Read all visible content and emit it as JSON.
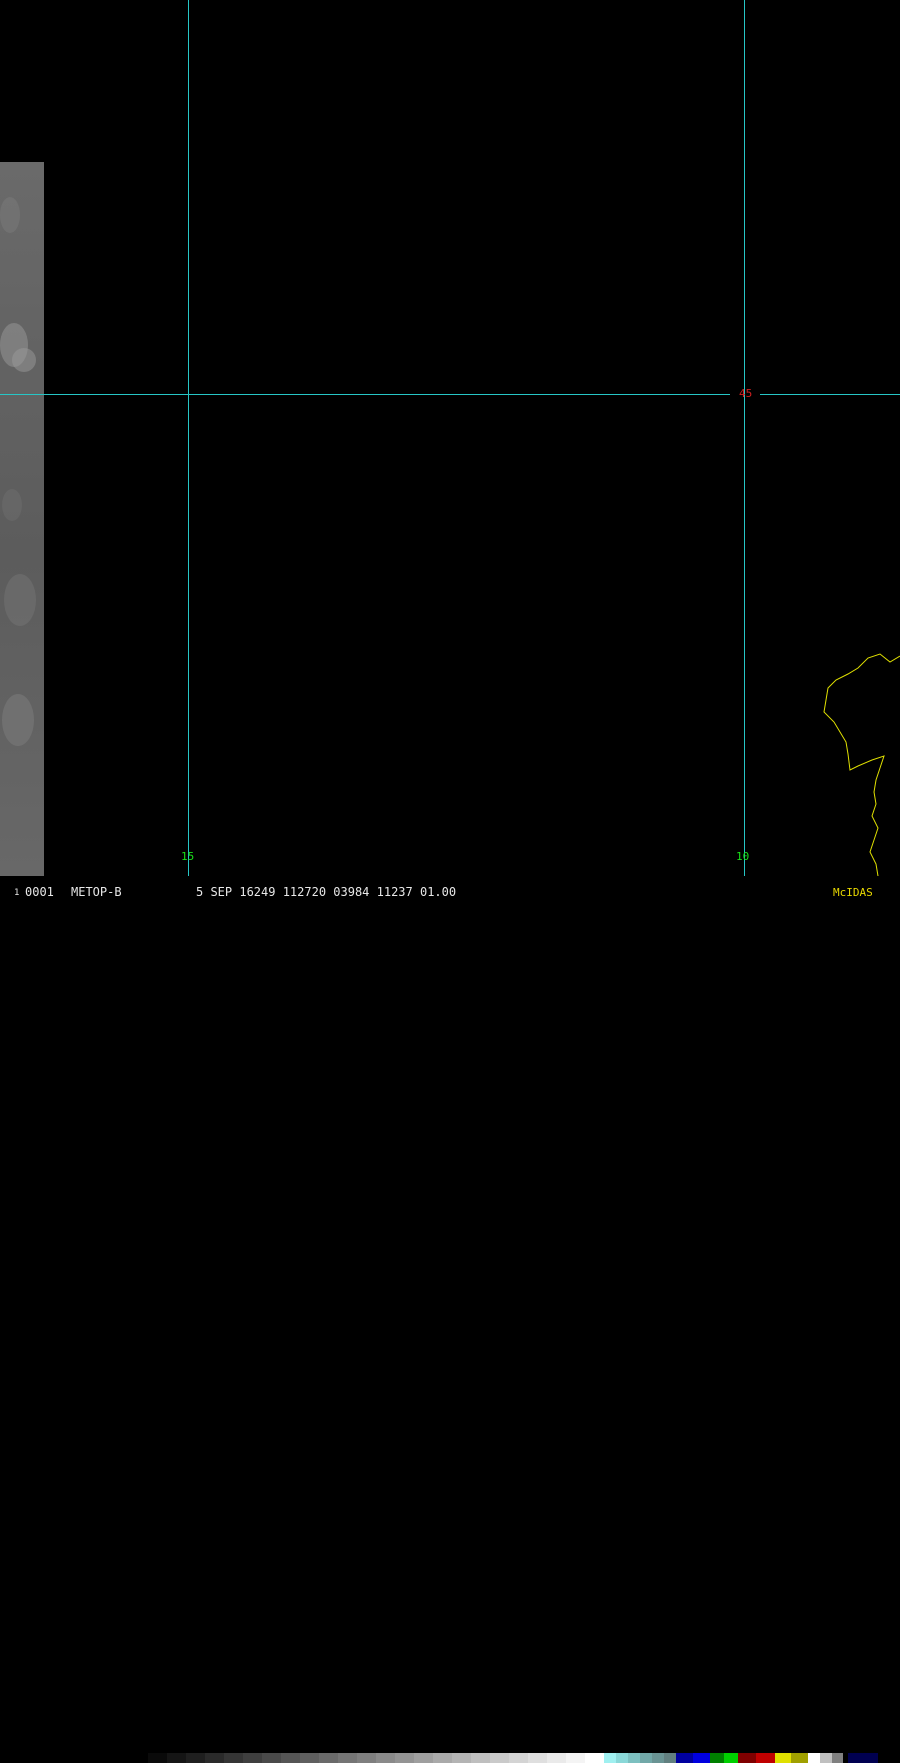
{
  "status_bar": {
    "frame_number": "1",
    "frame_id": "0001",
    "satellite": "METOP-B",
    "date_time": "5 SEP 16249 112720 03984 11237 01.00",
    "product": "McIDAS"
  },
  "grid": {
    "longitude_labels": [
      "15",
      "10"
    ],
    "latitude_labels": [
      "45"
    ]
  },
  "colors": {
    "grid_line": "#26c6c6",
    "coastline": "#e0e000",
    "lon_label": "#18e018",
    "lat_label": "#d02020",
    "status_text": "#e8e8e8",
    "mcidas_label": "#e8d800"
  }
}
